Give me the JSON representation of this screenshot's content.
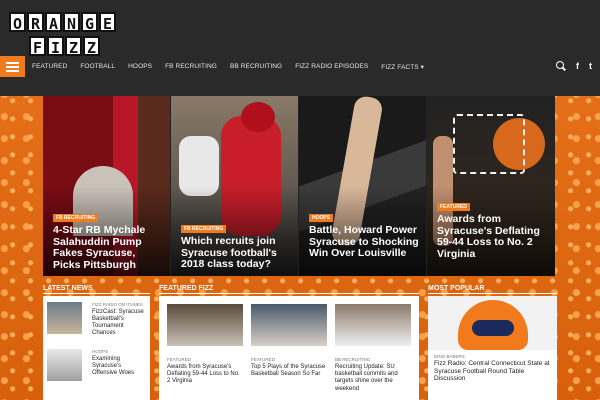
{
  "brand": {
    "logo_row1": [
      "O",
      "R",
      "A",
      "N",
      "G",
      "E"
    ],
    "logo_row2": [
      "F",
      "I",
      "Z",
      "Z"
    ]
  },
  "nav": {
    "items": [
      "FEATURED",
      "FOOTBALL",
      "HOOPS",
      "FB RECRUITING",
      "BB RECRUITING",
      "FIZZ RADIO EPISODES",
      "FIZZ FACTS ▾"
    ],
    "icons": [
      "search-icon",
      "facebook-icon",
      "twitter-icon"
    ],
    "facebook_glyph": "f",
    "twitter_glyph": "t"
  },
  "hero": [
    {
      "tag": "FB RECRUITING",
      "title": "4-Star RB Mychale Salahuddin Pump Fakes Syracuse, Picks Pittsburgh"
    },
    {
      "tag": "FB RECRUITING",
      "title": "Which recruits join Syracuse football's 2018 class today?"
    },
    {
      "tag": "HOOPS",
      "title": "Battle, Howard Power Syracuse to Shocking Win Over Louisville"
    },
    {
      "tag": "FEATURED",
      "title": "Awards from Syracuse's Deflating 59-44 Loss to No. 2 Virginia"
    }
  ],
  "sections": {
    "latest_news": "LATEST NEWS",
    "featured_fizz": "FEATURED FIZZ",
    "most_popular": "MOST POPULAR"
  },
  "latest": [
    {
      "tag": "FIZZ RADIO ON ITUNES",
      "title": "FizzCast: Syracuse Basketball's Tournament Chances"
    },
    {
      "tag": "HOOPS",
      "title": "Examining Syracuse's Offensive Woes"
    }
  ],
  "featured": [
    {
      "tag": "FEATURED",
      "title": "Awards from Syracuse's Deflating 59-44 Loss to No. 2 Virginia"
    },
    {
      "tag": "FEATURED",
      "title": "Top 5 Plays of the Syracuse Basketball Season So Far"
    },
    {
      "tag": "BB RECRUITING",
      "title": "Recruiting Update: SU basketball commits and targets shine over the weekend"
    }
  ],
  "popular": [
    {
      "tag": "DINO BABERS",
      "title": "Fizz Radio: Central Connecticut State at Syracuse Football Round Table Discussion"
    }
  ],
  "colors": {
    "accent": "#f07a1c",
    "header_bg": "#2a2a2a"
  }
}
